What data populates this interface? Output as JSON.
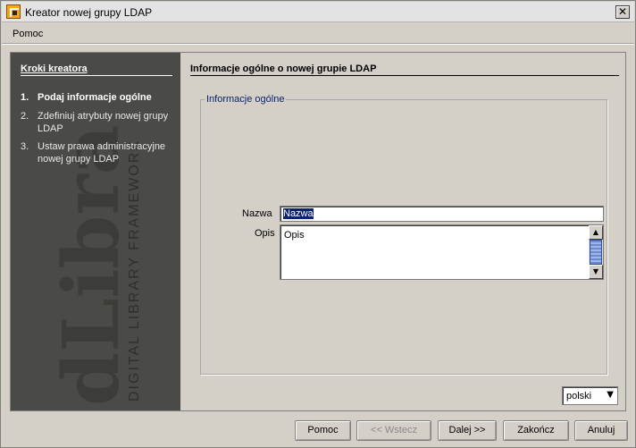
{
  "window": {
    "title": "Kreator nowej grupy LDAP"
  },
  "menu": {
    "help": "Pomoc"
  },
  "sidebar": {
    "title": "Kroki kreatora",
    "steps": [
      {
        "num": "1.",
        "label": "Podaj informacje ogólne",
        "active": true
      },
      {
        "num": "2.",
        "label": "Zdefiniuj atrybuty nowej grupy LDAP",
        "active": false
      },
      {
        "num": "3.",
        "label": "Ustaw prawa administracyjne nowej grupy LDAP",
        "active": false
      }
    ],
    "watermark_logo": "dLibra",
    "watermark_tagline": "DIGITAL LIBRARY FRAMEWORK"
  },
  "content": {
    "header": "Informacje ogólne o nowej grupie LDAP",
    "group_title": "Informacje ogólne",
    "name_label": "Nazwa",
    "name_value": "Nazwa",
    "desc_label": "Opis",
    "desc_value": "Opis"
  },
  "language": {
    "selected": "polski"
  },
  "buttons": {
    "help": "Pomoc",
    "back": "<< Wstecz",
    "next": "Dalej >>",
    "finish": "Zakończ",
    "cancel": "Anuluj"
  }
}
